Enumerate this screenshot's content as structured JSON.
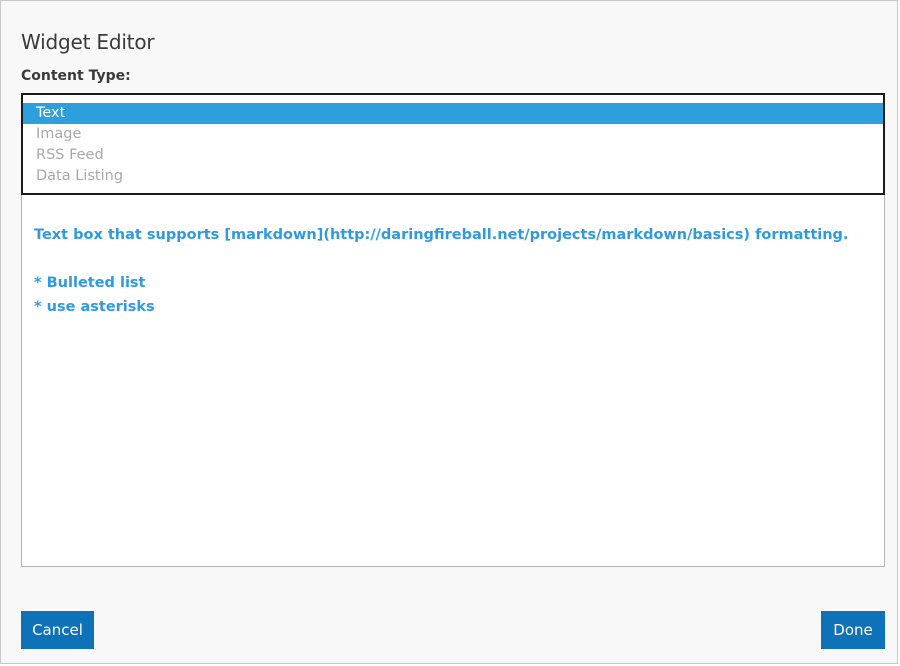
{
  "dialog": {
    "title": "Widget Editor",
    "content_type_label": "Content Type:"
  },
  "select": {
    "options": [
      {
        "label": "Text",
        "selected": true
      },
      {
        "label": "Image",
        "selected": false
      },
      {
        "label": "RSS Feed",
        "selected": false
      },
      {
        "label": "Data Listing",
        "selected": false
      }
    ]
  },
  "editor": {
    "lines": [
      "Text box that supports [markdown](http://daringfireball.net/projects/markdown/basics) formatting.",
      "* Bulleted list",
      "* use asterisks"
    ]
  },
  "footer": {
    "cancel_label": "Cancel",
    "done_label": "Done"
  },
  "colors": {
    "accent": "#0e72b8",
    "selection": "#2e9fdd",
    "content_text": "#2f9ae0"
  }
}
